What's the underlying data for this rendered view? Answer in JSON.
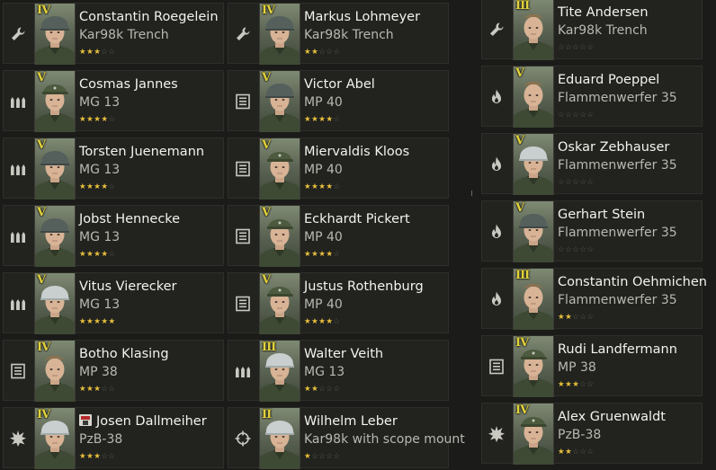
{
  "columns": [
    {
      "cards": [
        {
          "rank": "IV",
          "name": "Constantin Roegelein",
          "weapon": "Kar98k Trench",
          "stars_filled": 3,
          "stars_total": 5,
          "role_icon": "wrench-icon",
          "helmet": "dark",
          "medal": false
        },
        {
          "rank": "V",
          "name": "Cosmas Jannes",
          "weapon": "MG 13",
          "stars_filled": 4,
          "stars_total": 5,
          "role_icon": "ammo-belt-icon",
          "helmet": "cap",
          "medal": false
        },
        {
          "rank": "V",
          "name": "Torsten Juenemann",
          "weapon": "MG 13",
          "stars_filled": 4,
          "stars_total": 5,
          "role_icon": "ammo-belt-icon",
          "helmet": "dark",
          "medal": false
        },
        {
          "rank": "V",
          "name": "Jobst Hennecke",
          "weapon": "MG 13",
          "stars_filled": 4,
          "stars_total": 5,
          "role_icon": "ammo-belt-icon",
          "helmet": "dark",
          "medal": false
        },
        {
          "rank": "V",
          "name": "Vitus Vierecker",
          "weapon": "MG 13",
          "stars_filled": 5,
          "stars_total": 5,
          "role_icon": "ammo-belt-icon",
          "helmet": "white",
          "medal": false
        },
        {
          "rank": "IV",
          "name": "Botho Klasing",
          "weapon": "MP 38",
          "stars_filled": 3,
          "stars_total": 5,
          "role_icon": "magazine-icon",
          "helmet": "none",
          "medal": false
        },
        {
          "rank": "IV",
          "name": "Josen Dallmeiher",
          "weapon": "PzB-38",
          "stars_filled": 3,
          "stars_total": 5,
          "role_icon": "explosion-icon",
          "helmet": "white",
          "medal": true
        }
      ]
    },
    {
      "cards": [
        {
          "rank": "IV",
          "name": "Markus Lohmeyer",
          "weapon": "Kar98k Trench",
          "stars_filled": 2,
          "stars_total": 5,
          "role_icon": "wrench-icon",
          "helmet": "dark",
          "medal": false
        },
        {
          "rank": "V",
          "name": "Victor Abel",
          "weapon": "MP 40",
          "stars_filled": 4,
          "stars_total": 5,
          "role_icon": "magazine-icon",
          "helmet": "dark",
          "medal": false
        },
        {
          "rank": "V",
          "name": "Miervaldis Kloos",
          "weapon": "MP 40",
          "stars_filled": 4,
          "stars_total": 5,
          "role_icon": "magazine-icon",
          "helmet": "cap",
          "medal": false
        },
        {
          "rank": "V",
          "name": "Eckhardt Pickert",
          "weapon": "MP 40",
          "stars_filled": 4,
          "stars_total": 5,
          "role_icon": "magazine-icon",
          "helmet": "cap",
          "medal": false
        },
        {
          "rank": "V",
          "name": "Justus Rothenburg",
          "weapon": "MP 40",
          "stars_filled": 4,
          "stars_total": 5,
          "role_icon": "magazine-icon",
          "helmet": "cap",
          "medal": false
        },
        {
          "rank": "III",
          "name": "Walter Veith",
          "weapon": "MG 13",
          "stars_filled": 2,
          "stars_total": 5,
          "role_icon": "ammo-belt-icon",
          "helmet": "white",
          "medal": false
        },
        {
          "rank": "II",
          "name": "Wilhelm Leber",
          "weapon": "Kar98k with scope mount",
          "stars_filled": 1,
          "stars_total": 5,
          "role_icon": "crosshair-icon",
          "helmet": "white",
          "medal": false
        }
      ]
    },
    {
      "cards": [
        {
          "rank": "III",
          "name": "Tite Andersen",
          "weapon": "Kar98k Trench",
          "stars_filled": 0,
          "stars_total": 5,
          "role_icon": "wrench-icon",
          "helmet": "none",
          "medal": false
        },
        {
          "rank": "V",
          "name": "Eduard Poeppel",
          "weapon": "Flammenwerfer 35",
          "stars_filled": 0,
          "stars_total": 5,
          "role_icon": "flame-icon",
          "helmet": "none",
          "medal": false
        },
        {
          "rank": "V",
          "name": "Oskar Zebhauser",
          "weapon": "Flammenwerfer 35",
          "stars_filled": 0,
          "stars_total": 5,
          "role_icon": "flame-icon",
          "helmet": "white",
          "medal": false
        },
        {
          "rank": "V",
          "name": "Gerhart Stein",
          "weapon": "Flammenwerfer 35",
          "stars_filled": 0,
          "stars_total": 5,
          "role_icon": "flame-icon",
          "helmet": "dark",
          "medal": false
        },
        {
          "rank": "III",
          "name": "Constantin Oehmichen",
          "weapon": "Flammenwerfer 35",
          "stars_filled": 2,
          "stars_total": 5,
          "role_icon": "flame-icon",
          "helmet": "none",
          "medal": false
        },
        {
          "rank": "IV",
          "name": "Rudi Landfermann",
          "weapon": "MP 38",
          "stars_filled": 3,
          "stars_total": 5,
          "role_icon": "magazine-icon",
          "helmet": "cap",
          "medal": false
        },
        {
          "rank": "IV",
          "name": "Alex Gruenwaldt",
          "weapon": "PzB-38",
          "stars_filled": 2,
          "stars_total": 5,
          "role_icon": "explosion-icon",
          "helmet": "cap",
          "medal": false
        }
      ]
    }
  ],
  "colors": {
    "star_on": "#e8c13c",
    "star_off": "#5d5d56",
    "rank": "#e3d23a",
    "name": "#f2f2ee",
    "weapon": "#b9b9b1"
  }
}
